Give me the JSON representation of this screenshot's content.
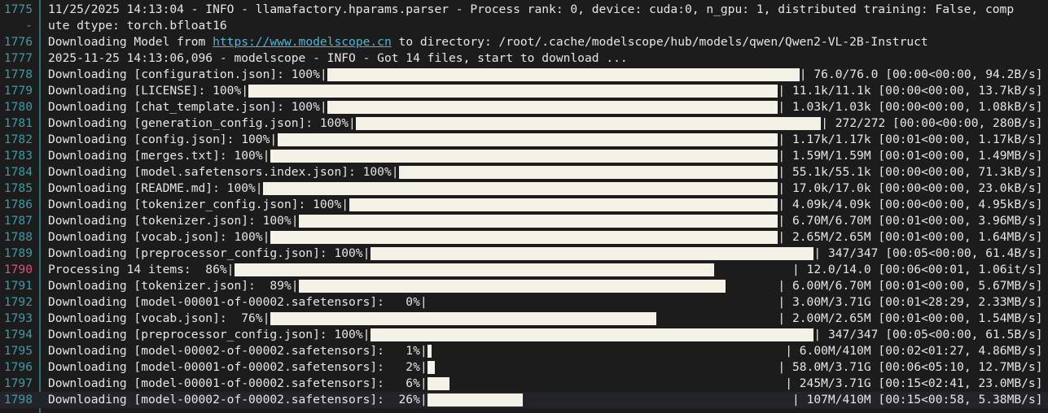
{
  "lines": [
    {
      "n": "1775",
      "t": "11/25/2025 14:13:04 - INFO - llamafactory.hparams.parser - Process rank: 0, device: cuda:0, n_gpu: 1, distributed training: False, comp"
    },
    {
      "n": "-",
      "t": "ute dtype: torch.bfloat16"
    },
    {
      "n": "1776",
      "t": "Downloading Model from ",
      "url": "https://www.modelscope.cn",
      "t2": " to directory: /root/.cache/modelscope/hub/models/qwen/Qwen2-VL-2B-Instruct"
    },
    {
      "n": "1777",
      "t": "2025-11-25 14:13:06,096 - modelscope - INFO - Got 14 files, start to download ..."
    }
  ],
  "bars": [
    {
      "n": "1778",
      "label": "Downloading [configuration.json]: 100%|",
      "pct": 1.0,
      "right": "| 76.0/76.0 [00:00<00:00, 94.2B/s]"
    },
    {
      "n": "1779",
      "label": "Downloading [LICENSE]: 100%|",
      "pct": 1.0,
      "right": "| 11.1k/11.1k [00:00<00:00, 13.7kB/s]"
    },
    {
      "n": "1780",
      "label": "Downloading [chat_template.json]: 100%|",
      "pct": 1.0,
      "right": "| 1.03k/1.03k [00:00<00:00, 1.08kB/s]"
    },
    {
      "n": "1781",
      "label": "Downloading [generation_config.json]: 100%|",
      "pct": 1.0,
      "right": "| 272/272 [00:00<00:00, 280B/s]"
    },
    {
      "n": "1782",
      "label": "Downloading [config.json]: 100%|",
      "pct": 1.0,
      "right": "| 1.17k/1.17k [00:01<00:00, 1.17kB/s]"
    },
    {
      "n": "1783",
      "label": "Downloading [merges.txt]: 100%|",
      "pct": 1.0,
      "right": "| 1.59M/1.59M [00:01<00:00, 1.49MB/s]"
    },
    {
      "n": "1784",
      "label": "Downloading [model.safetensors.index.json]: 100%|",
      "pct": 1.0,
      "right": "| 55.1k/55.1k [00:00<00:00, 71.3kB/s]"
    },
    {
      "n": "1785",
      "label": "Downloading [README.md]: 100%|",
      "pct": 1.0,
      "right": "| 17.0k/17.0k [00:00<00:00, 23.0kB/s]"
    },
    {
      "n": "1786",
      "label": "Downloading [tokenizer_config.json]: 100%|",
      "pct": 1.0,
      "right": "| 4.09k/4.09k [00:00<00:00, 4.95kB/s]"
    },
    {
      "n": "1787",
      "label": "Downloading [tokenizer.json]: 100%|",
      "pct": 1.0,
      "right": "| 6.70M/6.70M [00:01<00:00, 3.96MB/s]"
    },
    {
      "n": "1788",
      "label": "Downloading [vocab.json]: 100%|",
      "pct": 1.0,
      "right": "| 2.65M/2.65M [00:01<00:00, 1.64MB/s]"
    },
    {
      "n": "1789",
      "label": "Downloading [preprocessor_config.json]: 100%|",
      "pct": 1.0,
      "right": "| 347/347 [00:05<00:00, 61.4B/s]"
    },
    {
      "n": "1790",
      "label": "Processing 14 items:  86%|",
      "pct": 0.86,
      "right": "| 12.0/14.0 [00:06<00:01, 1.06it/s]",
      "current": true
    },
    {
      "n": "1791",
      "label": "Downloading [tokenizer.json]:  89%|",
      "pct": 0.89,
      "right": "| 6.00M/6.70M [00:01<00:00, 5.67MB/s]"
    },
    {
      "n": "1792",
      "label": "Downloading [model-00001-of-00002.safetensors]:   0%|",
      "pct": 0.0,
      "right": "| 3.00M/3.71G [00:01<28:29, 2.33MB/s]"
    },
    {
      "n": "1793",
      "label": "Downloading [vocab.json]:  76%|",
      "pct": 0.76,
      "right": "| 2.00M/2.65M [00:01<00:00, 1.54MB/s]"
    },
    {
      "n": "1794",
      "label": "Downloading [preprocessor_config.json]: 100%|",
      "pct": 1.0,
      "right": "| 347/347 [00:05<00:00, 61.5B/s]"
    },
    {
      "n": "1795",
      "label": "Downloading [model-00002-of-00002.safetensors]:   1%|",
      "pct": 0.01,
      "right": "| 6.00M/410M [00:02<01:27, 4.86MB/s]"
    },
    {
      "n": "1796",
      "label": "Downloading [model-00001-of-00002.safetensors]:   2%|",
      "pct": 0.02,
      "right": "| 58.0M/3.71G [00:06<05:10, 12.7MB/s]"
    },
    {
      "n": "1797",
      "label": "Downloading [model-00001-of-00002.safetensors]:   6%|",
      "pct": 0.06,
      "right": "| 245M/3.71G [00:15<02:41, 23.0MB/s]"
    },
    {
      "n": "1798",
      "label": "Downloading [model-00002-of-00002.safetensors]:  26%|",
      "pct": 0.26,
      "right": "| 107M/410M [00:15<00:58, 5.38MB/s]"
    }
  ]
}
